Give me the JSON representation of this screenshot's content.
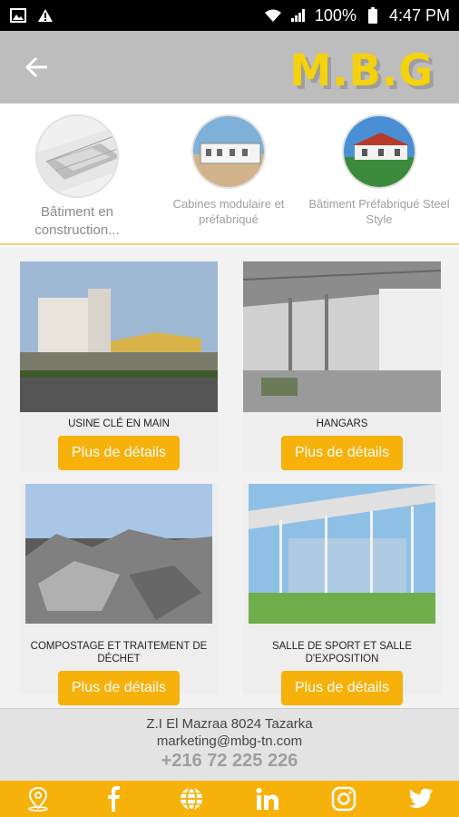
{
  "status_bar": {
    "battery": "100%",
    "time": "4:47 PM"
  },
  "header": {
    "logo": "M.B.G"
  },
  "categories": [
    {
      "label": "Bâtiment en construction..."
    },
    {
      "label": "Cabines modulaire et préfabriqué"
    },
    {
      "label": "Bâtiment Préfabriqué Steel Style"
    }
  ],
  "products": [
    {
      "title": "USINE CLÉ EN MAIN",
      "button": "Plus de détails"
    },
    {
      "title": "HANGARS",
      "button": "Plus de détails"
    },
    {
      "title": "COMPOSTAGE ET TRAITEMENT DE DÉCHET",
      "button": "Plus de détails"
    },
    {
      "title": "SALLE DE SPORT ET SALLE D'EXPOSITION",
      "button": "Plus de détails"
    }
  ],
  "footer": {
    "address": "Z.I El Mazraa 8024 Tazarka",
    "email": "marketing@mbg-tn.com",
    "phone": "+216 72 225 226"
  },
  "colors": {
    "accent": "#f6b10a",
    "logo": "#f5d20b",
    "appbar": "#bdbdbd"
  },
  "social_icons": [
    "location-icon",
    "facebook-icon",
    "web-icon",
    "linkedin-icon",
    "instagram-icon",
    "twitter-icon"
  ]
}
